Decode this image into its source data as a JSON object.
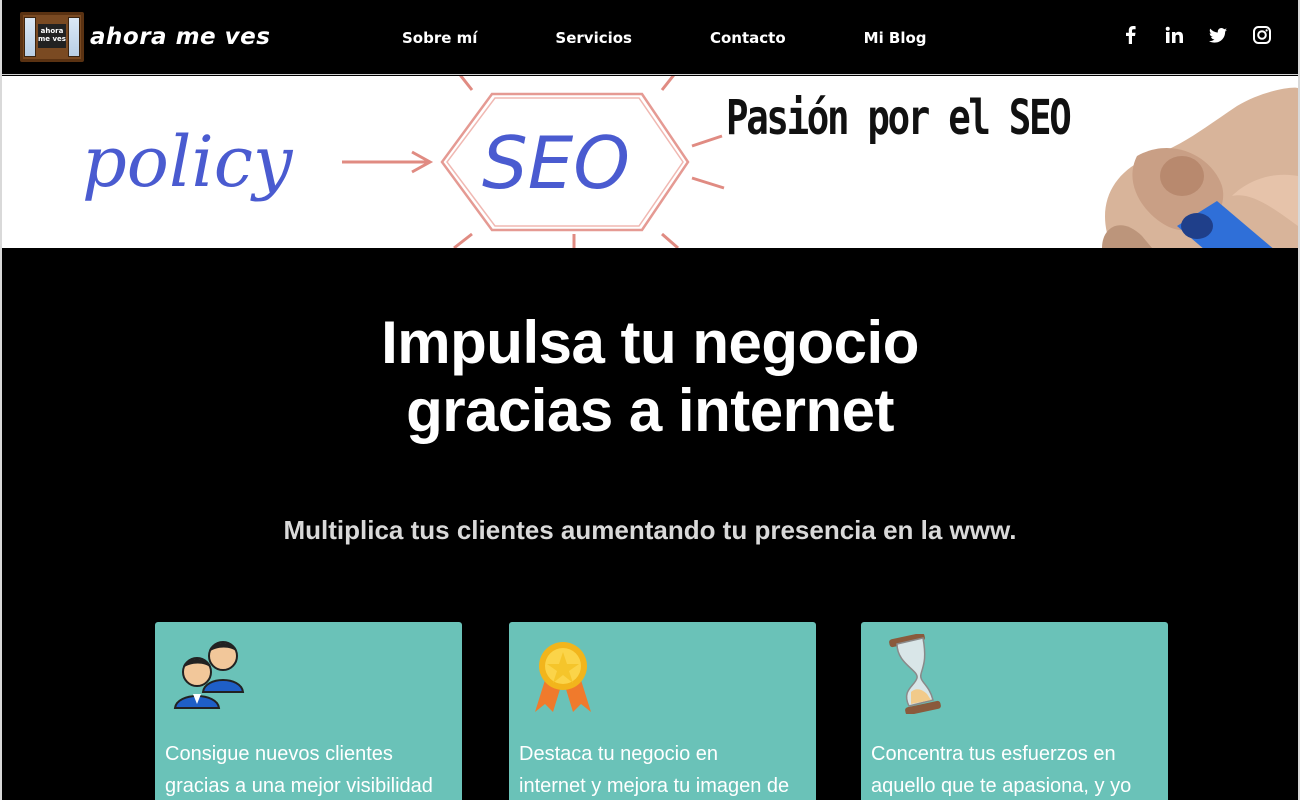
{
  "header": {
    "logo_text": "ahora me ves",
    "logo_board_text": "ahora me ves",
    "nav": [
      {
        "label": "Sobre mí"
      },
      {
        "label": "Servicios"
      },
      {
        "label": "Contacto"
      },
      {
        "label": "Mi Blog"
      }
    ],
    "social": [
      "facebook-icon",
      "linkedin-icon",
      "twitter-icon",
      "instagram-icon"
    ]
  },
  "banner": {
    "title": "Pasión por el SEO",
    "word_left": "policy",
    "word_center": "SEO"
  },
  "main": {
    "headline_line1": "Impulsa tu negocio",
    "headline_line2": "gracias a internet",
    "subhead": "Multiplica tus clientes aumentando tu presencia en la www.",
    "cards": [
      {
        "icon": "users-icon",
        "line1": "Consigue nuevos clientes",
        "line2": "gracias a una mejor visibilidad"
      },
      {
        "icon": "medal-icon",
        "line1": "Destaca tu negocio en",
        "line2": "internet y mejora tu imagen de"
      },
      {
        "icon": "hourglass-icon",
        "line1": "Concentra tus esfuerzos en",
        "line2": "aquello que te apasiona, y yo"
      }
    ]
  },
  "colors": {
    "nav_bg": "#000000",
    "card_bg": "#6ac2b8",
    "text_white": "#ffffff",
    "subhead": "#d9d9d9"
  }
}
